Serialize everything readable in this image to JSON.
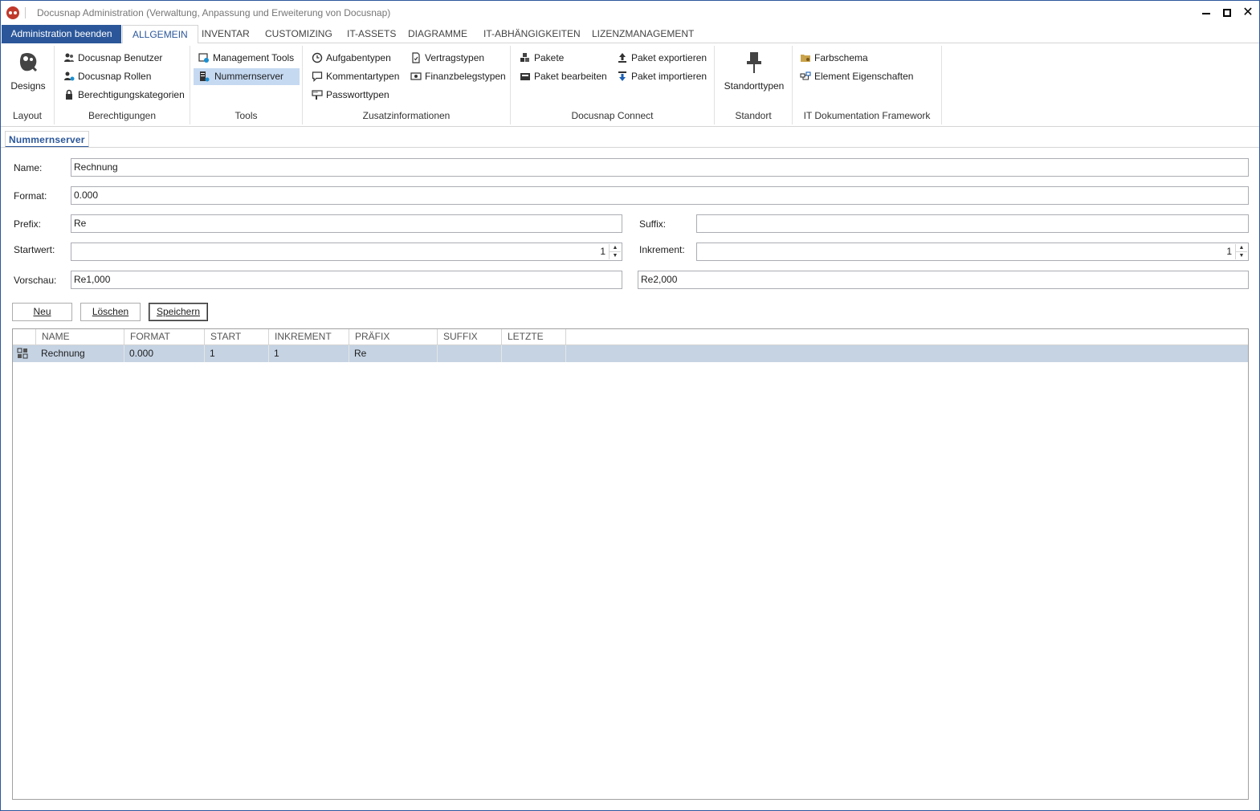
{
  "window": {
    "title": "Docusnap Administration (Verwaltung, Anpassung und Erweiterung von Docusnap)",
    "close_glyph": "✕"
  },
  "ribbon_tabs": {
    "file": "Administration beenden",
    "tabs": [
      "ALLGEMEIN",
      "INVENTAR",
      "CUSTOMIZING",
      "IT-ASSETS",
      "DIAGRAMME",
      "IT-ABHÄNGIGKEITEN",
      "LIZENZMANAGEMENT"
    ],
    "active": "ALLGEMEIN"
  },
  "ribbon": {
    "layout": {
      "label": "Layout",
      "designs": "Designs"
    },
    "berechtigungen": {
      "label": "Berechtigungen",
      "items": [
        "Docusnap Benutzer",
        "Docusnap Rollen",
        "Berechtigungskategorien"
      ]
    },
    "tools": {
      "label": "Tools",
      "items": [
        "Management Tools",
        "Nummernserver"
      ],
      "selected": "Nummernserver"
    },
    "zusatzinformationen": {
      "label": "Zusatzinformationen",
      "items": [
        "Aufgabentypen",
        "Kommentartypen",
        "Passworttypen",
        "Vertragstypen",
        "Finanzbelegstypen"
      ]
    },
    "docusnap_connect": {
      "label": "Docusnap Connect",
      "items": [
        "Pakete",
        "Paket bearbeiten",
        "Paket exportieren",
        "Paket importieren"
      ]
    },
    "standort": {
      "label": "Standort",
      "standorttypen": "Standorttypen"
    },
    "itdf": {
      "label": "IT Dokumentation Framework",
      "items": [
        "Farbschema",
        "Element Eigenschaften"
      ]
    }
  },
  "document_tab": "Nummernserver",
  "form": {
    "name_label": "Name:",
    "name_value": "Rechnung",
    "format_label": "Format:",
    "format_value": "0.000",
    "prefix_label": "Prefix:",
    "prefix_value": "Re",
    "suffix_label": "Suffix:",
    "suffix_value": "",
    "startwert_label": "Startwert:",
    "startwert_value": "1",
    "inkrement_label": "Inkrement:",
    "inkrement_value": "1",
    "vorschau_label": "Vorschau:",
    "vorschau_value_1": "Re1,000",
    "vorschau_value_2": "Re2,000"
  },
  "buttons": {
    "neu": "Neu",
    "loeschen": "Löschen",
    "speichern": "Speichern"
  },
  "grid": {
    "columns": [
      "NAME",
      "FORMAT",
      "START",
      "INKREMENT",
      "PRÄFIX",
      "SUFFIX",
      "LETZTE"
    ],
    "rows": [
      {
        "name": "Rechnung",
        "format": "0.000",
        "start": "1",
        "inkrement": "1",
        "praefix": "Re",
        "suffix": "",
        "letzte": ""
      }
    ]
  },
  "colors": {
    "accent": "#2b579a",
    "selection": "#c5d9f1",
    "row_selection": "#c5d3e3"
  }
}
